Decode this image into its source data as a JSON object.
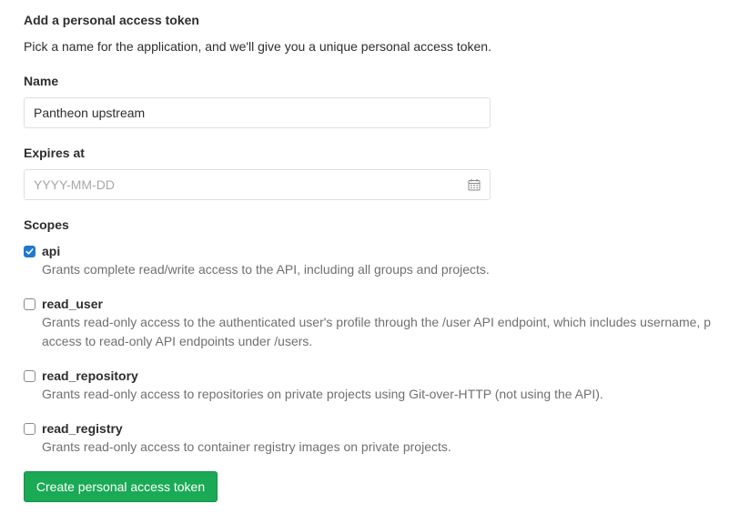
{
  "form": {
    "title": "Add a personal access token",
    "intro": "Pick a name for the application, and we'll give you a unique personal access token.",
    "name_label": "Name",
    "name_value": "Pantheon upstream",
    "expires_label": "Expires at",
    "expires_placeholder": "YYYY-MM-DD",
    "expires_icon": "calendar-icon",
    "scopes_label": "Scopes",
    "scopes": [
      {
        "name": "api",
        "checked": true,
        "description": "Grants complete read/write access to the API, including all groups and projects."
      },
      {
        "name": "read_user",
        "checked": false,
        "description_line1": "Grants read-only access to the authenticated user's profile through the /user API endpoint, which includes username, p",
        "description_line2": "access to read-only API endpoints under /users."
      },
      {
        "name": "read_repository",
        "checked": false,
        "description": "Grants read-only access to repositories on private projects using Git-over-HTTP (not using the API)."
      },
      {
        "name": "read_registry",
        "checked": false,
        "description": "Grants read-only access to container registry images on private projects."
      }
    ],
    "submit_label": "Create personal access token"
  },
  "colors": {
    "accent_checkbox": "#1f78d1",
    "submit_button": "#1aaa55",
    "muted_text": "#707070"
  }
}
